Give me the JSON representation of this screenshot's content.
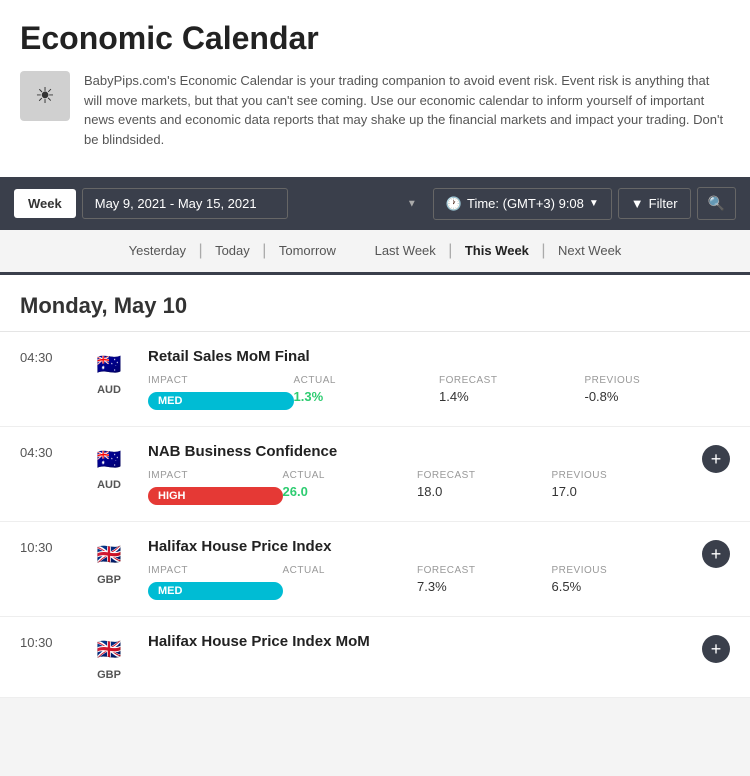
{
  "header": {
    "title": "Economic Calendar",
    "description": "BabyPips.com's Economic Calendar is your trading companion to avoid event risk. Event risk is anything that will move markets, but that you can't see coming. Use our economic calendar to inform yourself of important news events and economic data reports that may shake up the financial markets and impact your trading. Don't be blindsided.",
    "icon": "☀"
  },
  "toolbar": {
    "week_label": "Week",
    "date_range": "May 9, 2021 - May 15, 2021",
    "time_label": "Time: (GMT+3)  9:08",
    "filter_label": "Filter",
    "search_icon": "🔍"
  },
  "quick_nav": {
    "day_links": [
      "Yesterday",
      "Today",
      "Tomorrow"
    ],
    "week_links": [
      "Last Week",
      "This Week",
      "Next Week"
    ],
    "active": "This Week"
  },
  "calendar": {
    "days": [
      {
        "date": "Monday, May 10",
        "events": [
          {
            "time": "04:30",
            "title": "Retail Sales MoM Final",
            "currency": "AUD",
            "flag": "🇦🇺",
            "impact": "MED",
            "impact_class": "impact-med",
            "actual": "1.3%",
            "actual_class": "positive",
            "forecast": "1.4%",
            "previous": "-0.8%",
            "expandable": false
          },
          {
            "time": "04:30",
            "title": "NAB Business Confidence",
            "currency": "AUD",
            "flag": "🇦🇺",
            "impact": "HIGH",
            "impact_class": "impact-high",
            "actual": "26.0",
            "actual_class": "positive",
            "forecast": "18.0",
            "previous": "17.0",
            "expandable": true
          },
          {
            "time": "10:30",
            "title": "Halifax House Price Index",
            "currency": "GBP",
            "flag": "🇬🇧",
            "impact": "MED",
            "impact_class": "impact-med",
            "actual": "",
            "actual_class": "",
            "forecast": "7.3%",
            "previous": "6.5%",
            "expandable": true
          },
          {
            "time": "10:30",
            "title": "Halifax House Price Index MoM",
            "currency": "GBP",
            "flag": "🇬🇧",
            "impact": "",
            "impact_class": "",
            "actual": "",
            "actual_class": "",
            "forecast": "",
            "previous": "",
            "expandable": true
          }
        ]
      }
    ]
  },
  "labels": {
    "impact": "IMPACT",
    "actual": "ACTUAL",
    "forecast": "FORECAST",
    "previous": "PREVIOUS"
  }
}
